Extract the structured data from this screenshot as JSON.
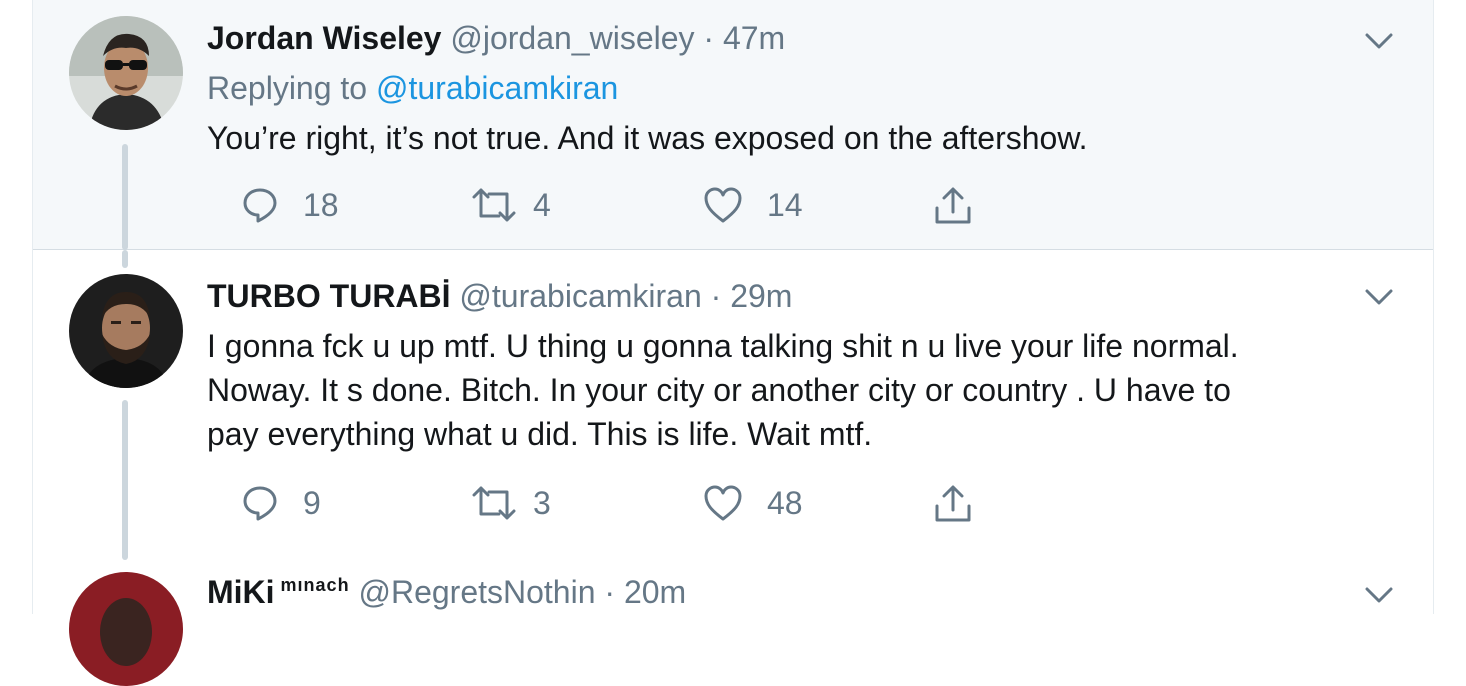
{
  "tweets": [
    {
      "name": "Jordan Wiseley",
      "handle": "@jordan_wiseley",
      "time": "47m",
      "replying_prefix": "Replying to ",
      "replying_to": "@turabicamkiran",
      "text": "You’re right, it’s not true. And it was exposed on the aftershow.",
      "replies": "18",
      "retweets": "4",
      "likes": "14"
    },
    {
      "name": "TURBO TURABİ",
      "handle": "@turabicamkiran",
      "time": "29m",
      "text_lines": [
        "I gonna fck u up mtf. U thing u gonna talking shit n u live your life normal.",
        "Noway.  It s done. Bitch. In your city or another city or country . U have to",
        "pay everything what u did. This is life.  Wait mtf."
      ],
      "replies": "9",
      "retweets": "3",
      "likes": "48"
    },
    {
      "name": "MiKi",
      "name_suffix": "mınach",
      "handle": "@RegretsNothin",
      "time": "20m"
    }
  ],
  "separator": " · ",
  "icons": [
    "reply-icon",
    "retweet-icon",
    "like-icon",
    "share-icon",
    "chevron-down-icon"
  ],
  "colors": {
    "link": "#1b95e0",
    "muted": "#657786",
    "highlight_bg": "#f5f8fa"
  }
}
